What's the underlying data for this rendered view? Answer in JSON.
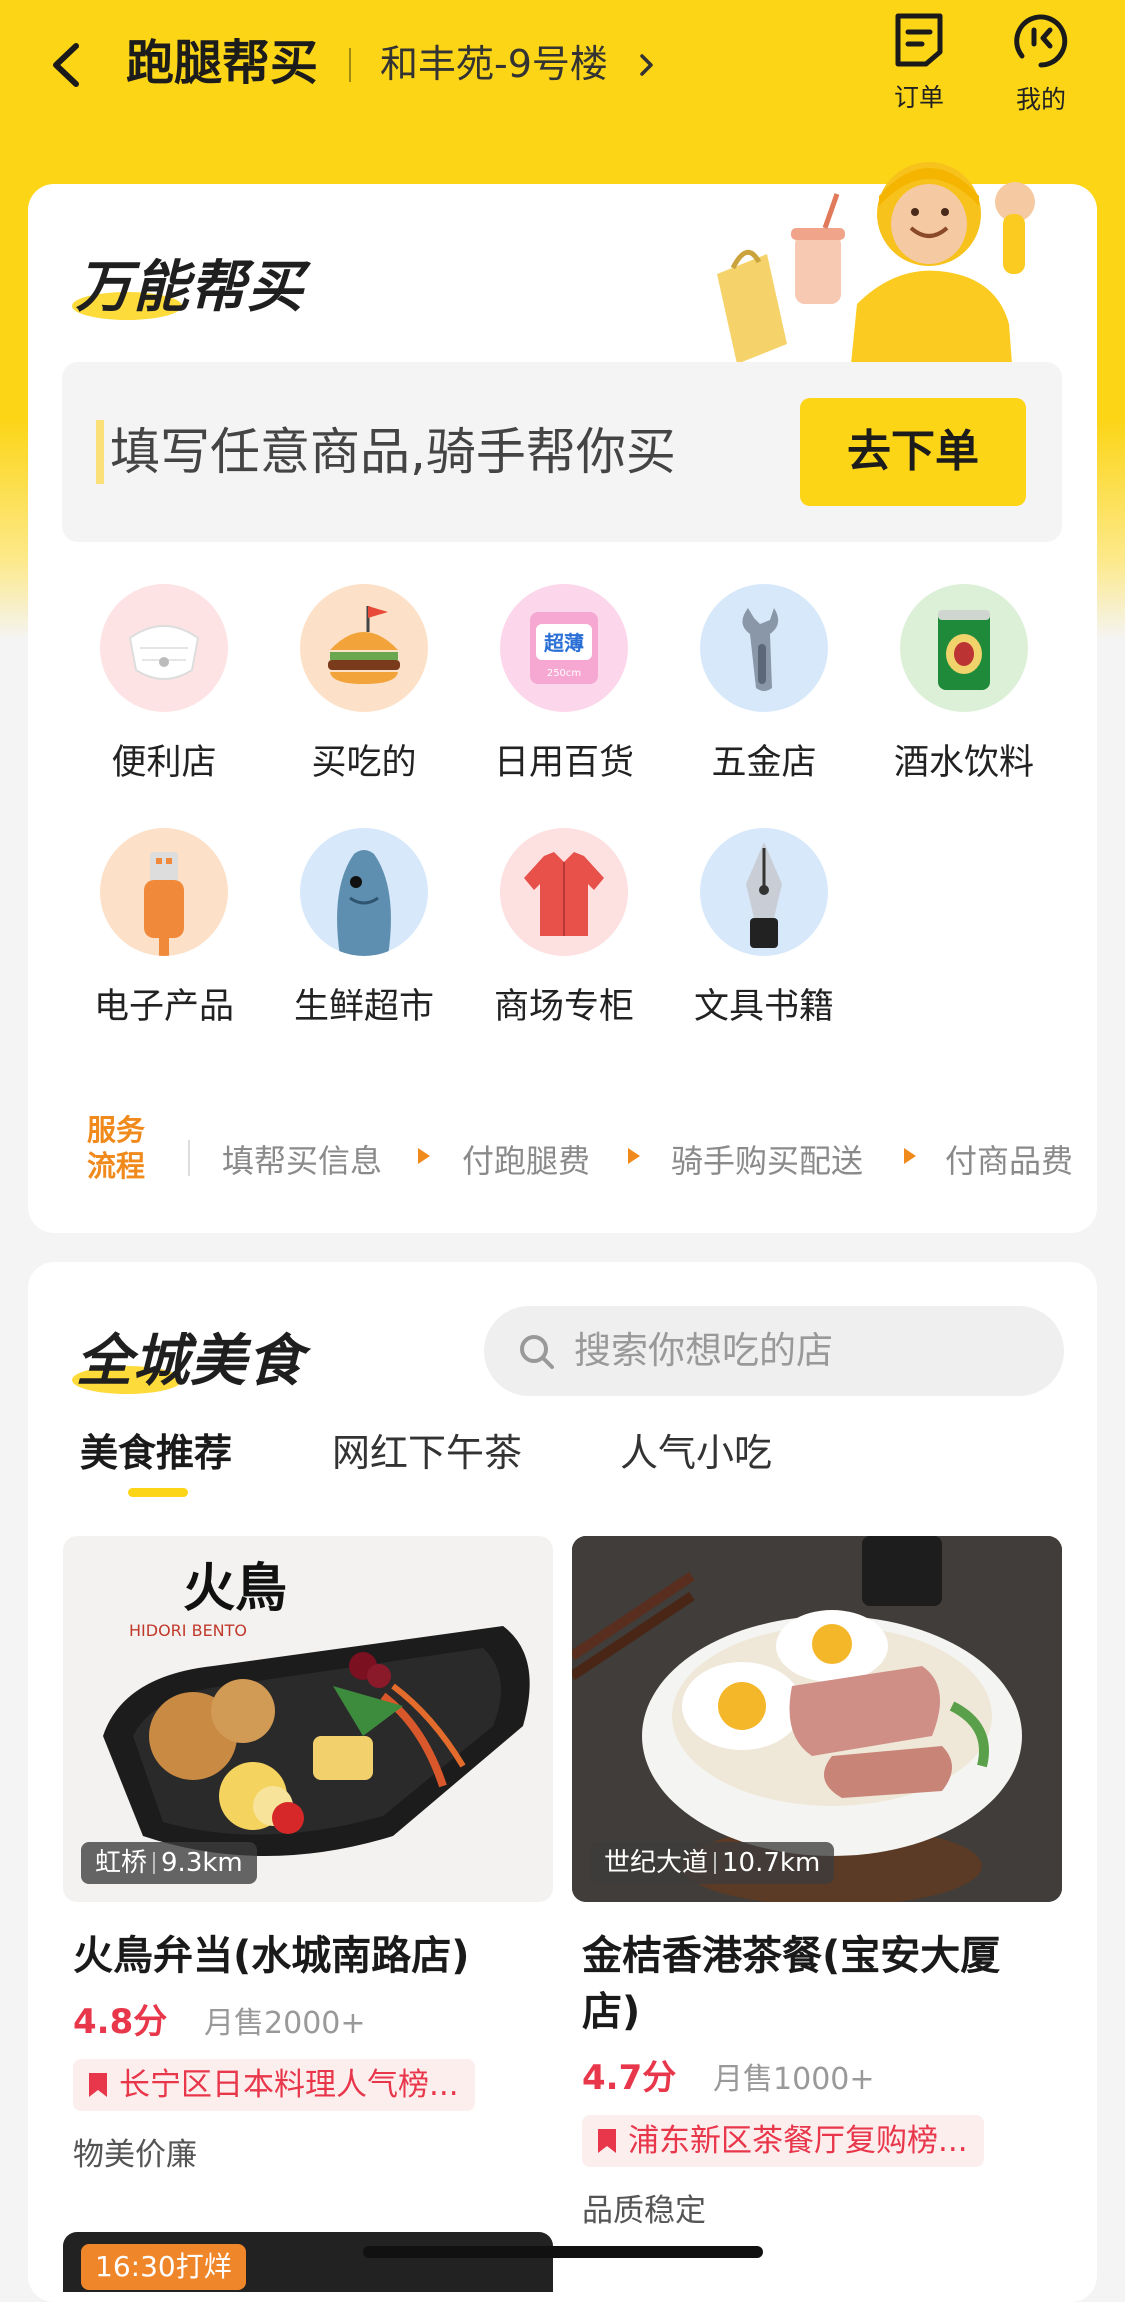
{
  "header": {
    "title": "跑腿帮买",
    "address": "和丰苑-9号楼",
    "orders_label": "订单",
    "mine_label": "我的"
  },
  "buy_section": {
    "title": "万能帮买",
    "input_placeholder": "填写任意商品,骑手帮你买",
    "order_button": "去下单",
    "categories": [
      {
        "label": "便利店",
        "icon": "mask-icon"
      },
      {
        "label": "买吃的",
        "icon": "burger-icon"
      },
      {
        "label": "日用百货",
        "icon": "pads-icon"
      },
      {
        "label": "五金店",
        "icon": "wrench-icon"
      },
      {
        "label": "酒水饮料",
        "icon": "beer-can-icon"
      },
      {
        "label": "电子产品",
        "icon": "usb-cable-icon"
      },
      {
        "label": "生鲜超市",
        "icon": "fish-icon"
      },
      {
        "label": "商场专柜",
        "icon": "shirt-icon"
      },
      {
        "label": "文具书籍",
        "icon": "fountain-pen-icon"
      }
    ],
    "pads_text": "超薄",
    "pads_size": "250cm",
    "flow": {
      "title": "服务流程",
      "steps": [
        "填帮买信息",
        "付跑腿费",
        "骑手购买配送",
        "付商品费"
      ]
    }
  },
  "food_section": {
    "title": "全城美食",
    "search_placeholder": "搜索你想吃的店",
    "tabs": [
      "美食推荐",
      "网红下午茶",
      "人气小吃"
    ],
    "shops": [
      {
        "name": "火鳥弁当(水城南路店)",
        "brand": "火鳥",
        "brand_sub": "HIDORI BENTO",
        "area": "虹桥",
        "distance": "9.3km",
        "rating": "4.8分",
        "sales": "月售2000+",
        "rank": "长宁区日本料理人气榜...",
        "tag": "物美价廉"
      },
      {
        "name": "金桔香港茶餐(宝安大厦店)",
        "area": "世纪大道",
        "distance": "10.7km",
        "rating": "4.7分",
        "sales": "月售1000+",
        "rank": "浦东新区茶餐厅复购榜...",
        "tag": "品质稳定"
      }
    ],
    "third_card_time": "16:30打烊"
  },
  "colors": {
    "brand_yellow": "#fcd517",
    "rating_red": "#e8364a",
    "flow_orange": "#f08a1c"
  }
}
